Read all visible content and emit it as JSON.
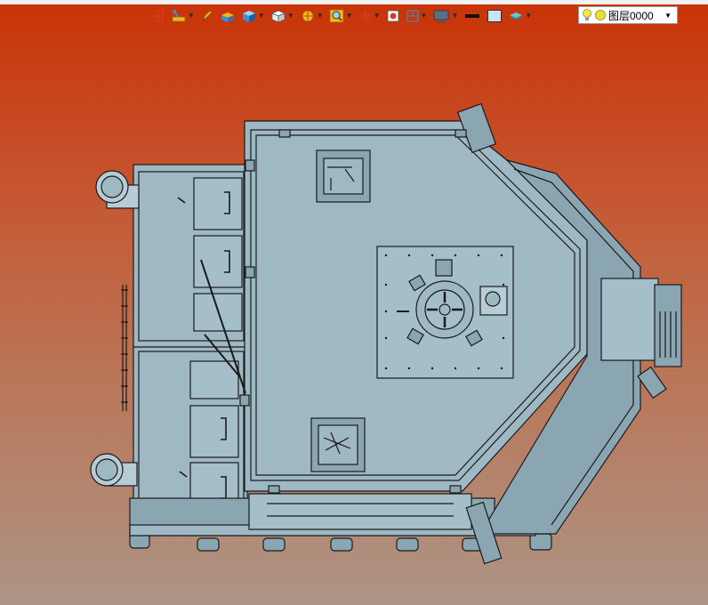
{
  "toolbar": {
    "tools": [
      {
        "name": "exit-icon",
        "dropdown": false
      },
      {
        "name": "measure-icon",
        "dropdown": true
      },
      {
        "name": "pencil-icon",
        "dropdown": false
      },
      {
        "name": "solid-box-icon",
        "dropdown": false
      },
      {
        "name": "cube-shaded-icon",
        "dropdown": true
      },
      {
        "name": "cube-view-icon",
        "dropdown": true
      },
      {
        "name": "section-icon",
        "dropdown": true
      },
      {
        "name": "zoom-icon",
        "dropdown": true
      },
      {
        "name": "pan-icon",
        "dropdown": true
      },
      {
        "name": "appearance-icon",
        "dropdown": false
      },
      {
        "name": "hide-show-icon",
        "dropdown": true
      },
      {
        "name": "display-icon",
        "dropdown": true
      },
      {
        "name": "line-color-icon",
        "dropdown": false
      },
      {
        "name": "background-color-icon",
        "dropdown": false
      },
      {
        "name": "layer-stack-icon",
        "dropdown": true
      }
    ],
    "colors": {
      "accent_blue": "#3b8fd8",
      "accent_yellow": "#f2b51b",
      "accent_red": "#d83a2a",
      "line_color": "#111111",
      "bg_swatch": "#c9e2f4"
    }
  },
  "layer": {
    "label": "图层0000",
    "bulb_color": "#f7e84a",
    "dot_color": "#e6e233"
  },
  "viewport": {
    "bg_top": "#c93306",
    "bg_bottom": "#ad9486",
    "model_fill": "#9eb9c4",
    "model_shade": "#8aa6b2",
    "model_stroke": "#1a1a1a"
  }
}
